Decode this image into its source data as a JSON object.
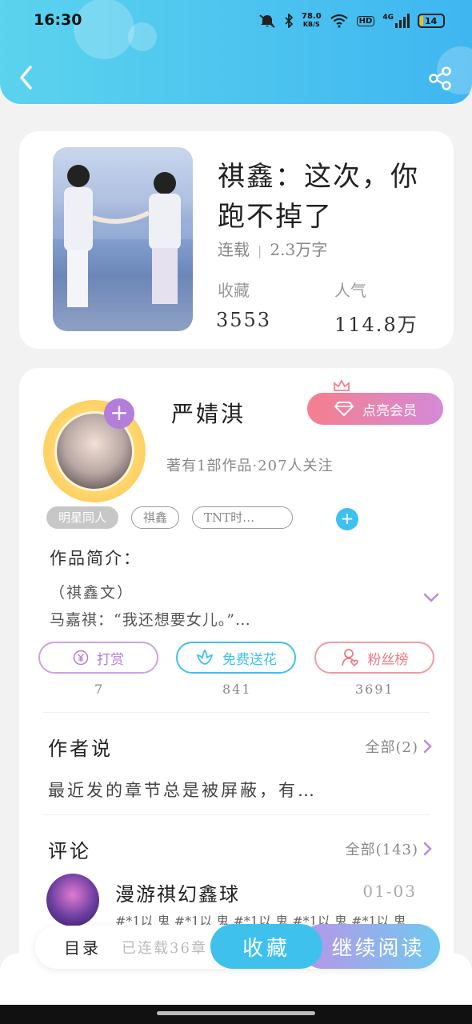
{
  "status_bar": {
    "time": "16:30",
    "net_speed_value": "78.0",
    "net_speed_unit": "KB/S",
    "hd": "HD",
    "network": "4G",
    "battery": "14",
    "battery_level": 0.14
  },
  "book": {
    "title": "祺鑫：这次，你跑不掉了",
    "status": "连载",
    "word_count": "2.3万字",
    "favorites_label": "收藏",
    "favorites_value": "3553",
    "popularity_label": "人气",
    "popularity_value": "114.8万"
  },
  "author": {
    "name": "严婧淇",
    "member_button": "点亮会员",
    "summary": "著有1部作品·207人关注",
    "tags": [
      "明星同人",
      "祺鑫",
      "TNT时…"
    ]
  },
  "intro": {
    "heading": "作品简介：",
    "line1": "（祺鑫文）",
    "line2": "马嘉祺：“我还想要女儿。”…"
  },
  "actions": [
    {
      "label": "打赏",
      "count": "7"
    },
    {
      "label": "免费送花",
      "count": "841"
    },
    {
      "label": "粉丝榜",
      "count": "3691"
    }
  ],
  "author_says": {
    "heading": "作者说",
    "more": "全部(2)",
    "text": "最近发的章节总是被屏蔽，有…"
  },
  "comments": {
    "heading": "评论",
    "more": "全部(143)",
    "user": "漫游祺幻鑫球",
    "date": "01-03",
    "text": "#*1以 鬼 #*1以 鬼 #*1以 鬼 #*1以 鬼 #*1以 鬼"
  },
  "bottom": {
    "toc": "目录",
    "serial": "已连载36章",
    "favorite": "收藏",
    "read": "继续阅读"
  },
  "colors": {
    "header": "#4cc4ef",
    "accent_blue": "#3fc1ee",
    "purple": "#b37ddc",
    "pink": "#f57f8d"
  }
}
